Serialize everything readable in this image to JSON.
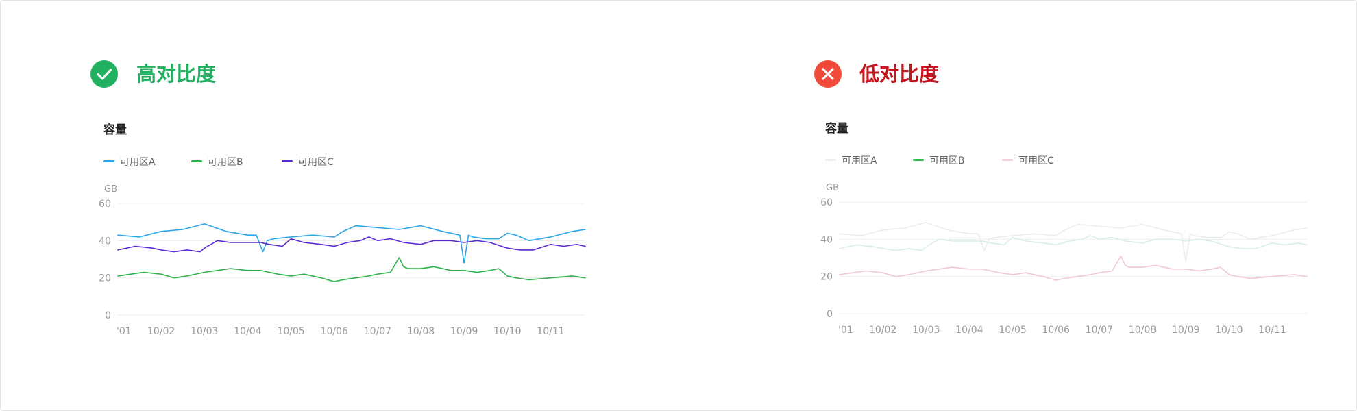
{
  "colors": {
    "good": "#22b161",
    "bad_badge": "#f04b3a",
    "bad_heading": "#c4161c",
    "axis_text": "#999999",
    "grid": "#eeeeee"
  },
  "good_panel": {
    "icon": "check-circle-icon",
    "heading": "高对比度",
    "chart_title": "容量",
    "legend": [
      {
        "label": "可用区A",
        "color": "#2aa6e8"
      },
      {
        "label": "可用区B",
        "color": "#2fb24a"
      },
      {
        "label": "可用区C",
        "color": "#5a2ad0"
      }
    ]
  },
  "bad_panel": {
    "icon": "close-circle-icon",
    "heading": "低对比度",
    "chart_title": "容量",
    "legend": [
      {
        "label": "可用区A",
        "color": "#e9eeea"
      },
      {
        "label": "可用区B",
        "color": "#2fb24a"
      },
      {
        "label": "可用区C",
        "color": "#f0c9d2"
      }
    ]
  },
  "chart_data": [
    {
      "type": "line",
      "title": "容量",
      "ylabel": "GB",
      "ylim": [
        0,
        60
      ],
      "yticks": [
        0,
        20,
        40,
        60
      ],
      "xticks": [
        "'01",
        "10/02",
        "10/03",
        "10/04",
        "10/05",
        "10/06",
        "10/07",
        "10/08",
        "10/09",
        "10/10",
        "10/11"
      ],
      "xlim": [
        1,
        11.8
      ],
      "legend": "top-left",
      "grid": true,
      "series": [
        {
          "name": "可用区A",
          "color": "#2aa6e8",
          "x": [
            1,
            1.5,
            2,
            2.5,
            3,
            3.5,
            4,
            4.2,
            4.35,
            4.45,
            4.6,
            5,
            5.5,
            6,
            6.2,
            6.5,
            7,
            7.5,
            8,
            8.5,
            8.9,
            9,
            9.1,
            9.2,
            9.5,
            9.8,
            10,
            10.2,
            10.5,
            11,
            11.5,
            11.8
          ],
          "y": [
            43,
            42,
            45,
            46,
            49,
            45,
            43,
            43,
            34,
            40,
            41,
            42,
            43,
            42,
            45,
            48,
            47,
            46,
            48,
            45,
            43,
            28,
            43,
            42,
            41,
            41,
            44,
            43,
            40,
            42,
            45,
            46
          ]
        },
        {
          "name": "可用区B",
          "color": "#2fb24a",
          "x": [
            1,
            1.3,
            1.6,
            2,
            2.3,
            2.6,
            3,
            3.3,
            3.6,
            4,
            4.3,
            4.7,
            5,
            5.3,
            5.7,
            6,
            6.2,
            6.5,
            6.8,
            7,
            7.3,
            7.5,
            7.6,
            7.7,
            8,
            8.3,
            8.7,
            9,
            9.3,
            9.6,
            9.8,
            10,
            10.2,
            10.5,
            11,
            11.5,
            11.8
          ],
          "y": [
            21,
            22,
            23,
            22,
            20,
            21,
            23,
            24,
            25,
            24,
            24,
            22,
            21,
            22,
            20,
            18,
            19,
            20,
            21,
            22,
            23,
            31,
            26,
            25,
            25,
            26,
            24,
            24,
            23,
            24,
            25,
            21,
            20,
            19,
            20,
            21,
            20
          ]
        },
        {
          "name": "可用区C",
          "color": "#5a2ad0",
          "x": [
            1,
            1.4,
            1.8,
            2,
            2.3,
            2.6,
            2.9,
            3,
            3.3,
            3.6,
            4,
            4.3,
            4.5,
            4.8,
            5,
            5.3,
            5.7,
            6,
            6.3,
            6.6,
            6.8,
            7,
            7.3,
            7.6,
            8,
            8.3,
            8.7,
            9,
            9.3,
            9.6,
            10,
            10.3,
            10.6,
            11,
            11.3,
            11.6,
            11.8
          ],
          "y": [
            35,
            37,
            36,
            35,
            34,
            35,
            34,
            36,
            40,
            39,
            39,
            39,
            38,
            37,
            41,
            39,
            38,
            37,
            39,
            40,
            42,
            40,
            41,
            39,
            38,
            40,
            40,
            39,
            40,
            39,
            36,
            35,
            35,
            38,
            37,
            38,
            37
          ]
        }
      ]
    },
    {
      "type": "line",
      "title": "容量",
      "ylabel": "GB",
      "ylim": [
        0,
        60
      ],
      "yticks": [
        0,
        20,
        40,
        60
      ],
      "xticks": [
        "'01",
        "10/02",
        "10/03",
        "10/04",
        "10/05",
        "10/06",
        "10/07",
        "10/08",
        "10/09",
        "10/10",
        "10/11"
      ],
      "xlim": [
        1,
        11.8
      ],
      "legend": "top-left",
      "grid": true,
      "series": [
        {
          "name": "可用区A",
          "color": "#e9eeea",
          "x": [
            1,
            1.5,
            2,
            2.5,
            3,
            3.5,
            4,
            4.2,
            4.35,
            4.45,
            4.6,
            5,
            5.5,
            6,
            6.2,
            6.5,
            7,
            7.5,
            8,
            8.5,
            8.9,
            9,
            9.1,
            9.2,
            9.5,
            9.8,
            10,
            10.2,
            10.5,
            11,
            11.5,
            11.8
          ],
          "y": [
            43,
            42,
            45,
            46,
            49,
            45,
            43,
            43,
            34,
            40,
            41,
            42,
            43,
            42,
            45,
            48,
            47,
            46,
            48,
            45,
            43,
            28,
            43,
            42,
            41,
            41,
            44,
            43,
            40,
            42,
            45,
            46
          ]
        },
        {
          "name": "可用区B",
          "color": "#d9efe3",
          "x": [
            1,
            1.4,
            1.8,
            2,
            2.3,
            2.6,
            2.9,
            3,
            3.3,
            3.6,
            4,
            4.3,
            4.5,
            4.8,
            5,
            5.3,
            5.7,
            6,
            6.3,
            6.6,
            6.8,
            7,
            7.3,
            7.6,
            8,
            8.3,
            8.7,
            9,
            9.3,
            9.6,
            10,
            10.3,
            10.6,
            11,
            11.3,
            11.6,
            11.8
          ],
          "y": [
            35,
            37,
            36,
            35,
            34,
            35,
            34,
            36,
            40,
            39,
            39,
            39,
            38,
            37,
            41,
            39,
            38,
            37,
            39,
            40,
            42,
            40,
            41,
            39,
            38,
            40,
            40,
            39,
            40,
            39,
            36,
            35,
            35,
            38,
            37,
            38,
            37
          ]
        },
        {
          "name": "可用区C",
          "color": "#f0c9d2",
          "x": [
            1,
            1.3,
            1.6,
            2,
            2.3,
            2.6,
            3,
            3.3,
            3.6,
            4,
            4.3,
            4.7,
            5,
            5.3,
            5.7,
            6,
            6.2,
            6.5,
            6.8,
            7,
            7.3,
            7.5,
            7.6,
            7.7,
            8,
            8.3,
            8.7,
            9,
            9.3,
            9.6,
            9.8,
            10,
            10.2,
            10.5,
            11,
            11.5,
            11.8
          ],
          "y": [
            21,
            22,
            23,
            22,
            20,
            21,
            23,
            24,
            25,
            24,
            24,
            22,
            21,
            22,
            20,
            18,
            19,
            20,
            21,
            22,
            23,
            31,
            26,
            25,
            25,
            26,
            24,
            24,
            23,
            24,
            25,
            21,
            20,
            19,
            20,
            21,
            20
          ]
        }
      ]
    }
  ]
}
